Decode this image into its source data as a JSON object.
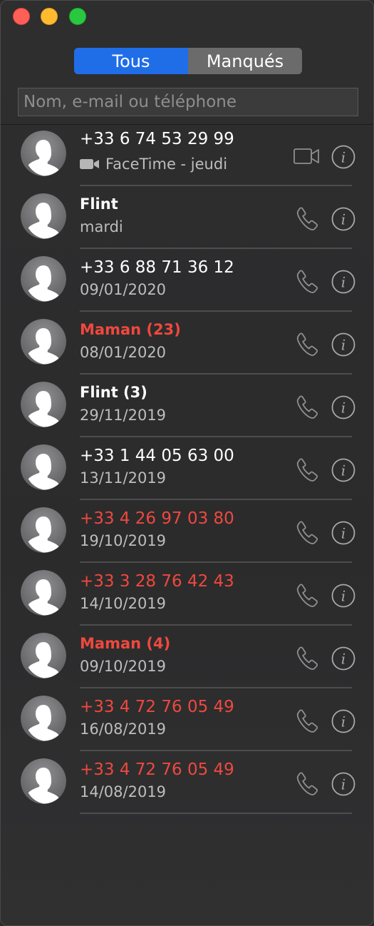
{
  "window": {
    "traffic_lights": {
      "close": "#fe5f57",
      "minimize": "#febb2e",
      "maximize": "#29c840"
    }
  },
  "segmented": {
    "all_label": "Tous",
    "missed_label": "Manqués",
    "accent": "#1f6ee8"
  },
  "search": {
    "placeholder": "Nom, e-mail ou téléphone"
  },
  "calls": [
    {
      "name": "+33 6 74 53 29 99",
      "detail": "FaceTime - jeudi",
      "kind": "facetime-video",
      "missed": false,
      "bold": false
    },
    {
      "name": "Flint",
      "detail": "mardi",
      "kind": "audio",
      "missed": false,
      "bold": true
    },
    {
      "name": "+33 6 88 71 36 12",
      "detail": "09/01/2020",
      "kind": "audio",
      "missed": false,
      "bold": false
    },
    {
      "name": "Maman (23)",
      "detail": "08/01/2020",
      "kind": "audio",
      "missed": true,
      "bold": true
    },
    {
      "name": "Flint (3)",
      "detail": "29/11/2019",
      "kind": "audio",
      "missed": false,
      "bold": true
    },
    {
      "name": "+33 1 44 05 63 00",
      "detail": "13/11/2019",
      "kind": "audio",
      "missed": false,
      "bold": false
    },
    {
      "name": "+33 4 26 97 03 80",
      "detail": "19/10/2019",
      "kind": "audio",
      "missed": true,
      "bold": false
    },
    {
      "name": "+33 3 28 76 42 43",
      "detail": "14/10/2019",
      "kind": "audio",
      "missed": true,
      "bold": false
    },
    {
      "name": "Maman (4)",
      "detail": "09/10/2019",
      "kind": "audio",
      "missed": true,
      "bold": true
    },
    {
      "name": "+33 4 72 76 05 49",
      "detail": "16/08/2019",
      "kind": "audio",
      "missed": true,
      "bold": false
    },
    {
      "name": "+33 4 72 76 05 49",
      "detail": "14/08/2019",
      "kind": "audio",
      "missed": true,
      "bold": false
    }
  ],
  "colors": {
    "missed": "#f0483e",
    "text": "#ffffff",
    "secondary": "#bdbdbe",
    "icon": "#8f8f90"
  }
}
